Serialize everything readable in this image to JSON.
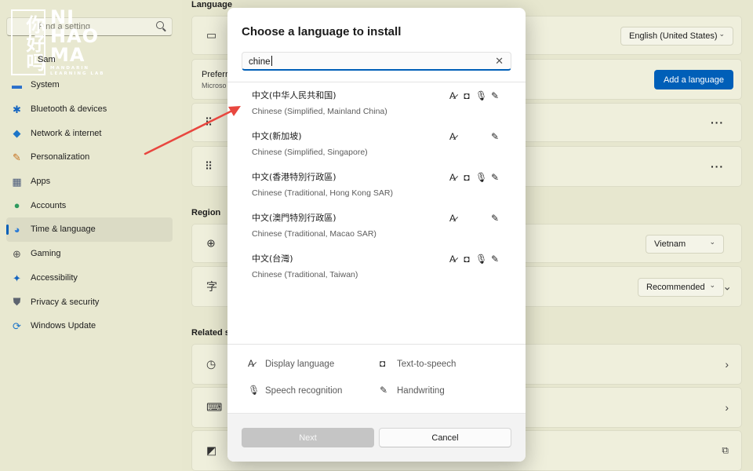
{
  "sidebar": {
    "search_placeholder": "Find a setting",
    "logo": {
      "chinese": "你好吗",
      "english": "NI HAO MA",
      "tagline": "MANDARIN LEARNING LAB"
    },
    "profile_label": "Sam",
    "items": [
      {
        "label": "System",
        "icon": "system-icon"
      },
      {
        "label": "Bluetooth & devices",
        "icon": "bluetooth-icon"
      },
      {
        "label": "Network & internet",
        "icon": "wifi-icon"
      },
      {
        "label": "Personalization",
        "icon": "brush-icon"
      },
      {
        "label": "Apps",
        "icon": "apps-icon"
      },
      {
        "label": "Accounts",
        "icon": "person-icon"
      },
      {
        "label": "Time & language",
        "icon": "globe-clock-icon"
      },
      {
        "label": "Gaming",
        "icon": "gamepad-icon"
      },
      {
        "label": "Accessibility",
        "icon": "accessibility-icon"
      },
      {
        "label": "Privacy & security",
        "icon": "shield-icon"
      },
      {
        "label": "Windows Update",
        "icon": "update-icon"
      }
    ],
    "active_index": 6
  },
  "content": {
    "language_section": "Language",
    "windows_display_language": "English (United States)",
    "preferred_label": "Preferre",
    "preferred_sub": "Microso",
    "add_language": "Add a language",
    "region_section": "Region",
    "country_value": "Vietnam",
    "regional_format_value": "Recommended",
    "related_section": "Related se"
  },
  "modal": {
    "title": "Choose a language to install",
    "search_value": "chine",
    "languages": [
      {
        "native": "中文(中华人民共和国)",
        "english": "Chinese (Simplified, Mainland China)",
        "features": [
          "display",
          "tts",
          "speech",
          "handwriting"
        ]
      },
      {
        "native": "中文(新加坡)",
        "english": "Chinese (Simplified, Singapore)",
        "features": [
          "display",
          "handwriting"
        ]
      },
      {
        "native": "中文(香港特別行政區)",
        "english": "Chinese (Traditional, Hong Kong SAR)",
        "features": [
          "display",
          "tts",
          "speech",
          "handwriting"
        ]
      },
      {
        "native": "中文(澳門特別行政區)",
        "english": "Chinese (Traditional, Macao SAR)",
        "features": [
          "display",
          "handwriting"
        ]
      },
      {
        "native": "中文(台灣)",
        "english": "Chinese (Traditional, Taiwan)",
        "features": [
          "display",
          "tts",
          "speech",
          "handwriting"
        ]
      }
    ],
    "legend": {
      "display": "Display language",
      "tts": "Text-to-speech",
      "speech": "Speech recognition",
      "handwriting": "Handwriting"
    },
    "next_label": "Next",
    "cancel_label": "Cancel"
  },
  "colors": {
    "accent": "#005fb8",
    "background": "#e7e7cf",
    "arrow": "#e8473f"
  }
}
